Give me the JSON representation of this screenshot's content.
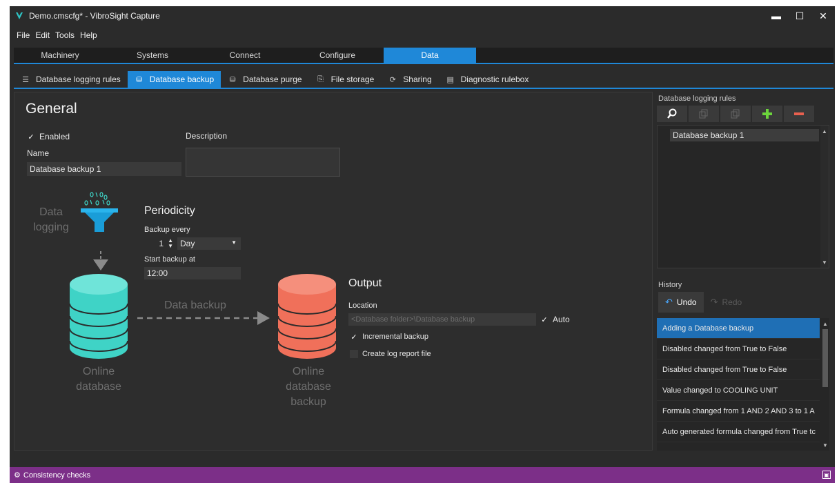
{
  "window": {
    "title": "Demo.cmscfg* - VibroSight Capture",
    "controls": {
      "minimize": "▬",
      "maximize": "☐",
      "close": "✕"
    }
  },
  "menu": [
    "File",
    "Edit",
    "Tools",
    "Help"
  ],
  "main_tabs": [
    {
      "label": "Machinery"
    },
    {
      "label": "Systems"
    },
    {
      "label": "Connect"
    },
    {
      "label": "Configure"
    },
    {
      "label": "Data"
    }
  ],
  "main_tab_active": "Data",
  "sub_tabs": [
    {
      "label": "Database logging rules",
      "icon": "list-rules-icon"
    },
    {
      "label": "Database backup",
      "icon": "database-backup-icon"
    },
    {
      "label": "Database purge",
      "icon": "database-purge-icon"
    },
    {
      "label": "File storage",
      "icon": "file-storage-icon"
    },
    {
      "label": "Sharing",
      "icon": "sharing-icon"
    },
    {
      "label": "Diagnostic rulebox",
      "icon": "rulebox-icon"
    }
  ],
  "sub_tab_active": "Database backup",
  "general": {
    "heading": "General",
    "enabled_label": "Enabled",
    "enabled": true,
    "name_label": "Name",
    "name_value": "Database backup 1",
    "description_label": "Description",
    "description_value": ""
  },
  "diagram": {
    "data_logging": "Data logging",
    "online_database": "Online database",
    "arrow_label": "Data backup",
    "online_backup": "Online database backup",
    "colors": {
      "online": "#3fd3c6",
      "backup": "#f0705a",
      "funnel": "#1a9dd8"
    }
  },
  "periodicity": {
    "heading": "Periodicity",
    "backup_every_label": "Backup every",
    "backup_every_value": "1",
    "unit_value": "Day",
    "start_label": "Start backup at",
    "start_value": "12:00"
  },
  "output": {
    "heading": "Output",
    "location_label": "Location",
    "location_value": "<Database folder>\\Database backup",
    "auto_label": "Auto",
    "auto": true,
    "incremental_label": "Incremental backup",
    "incremental": true,
    "log_report_label": "Create log report file",
    "log_report": false
  },
  "rules_panel": {
    "title": "Database logging rules",
    "items": [
      "Database backup 1"
    ]
  },
  "history": {
    "title": "History",
    "undo_label": "Undo",
    "redo_label": "Redo",
    "rows": [
      "Adding a Database backup",
      "Disabled changed from True to False",
      "Disabled changed from True to False",
      "Value changed to COOLING UNIT",
      "Formula changed from 1 AND 2 AND 3 to 1 A",
      "Auto generated formula changed from True tc"
    ]
  },
  "status": {
    "label": "Consistency checks"
  },
  "colors": {
    "accent": "#1f88d8",
    "status_bar": "#7c2f88",
    "background": "#2b2b2b"
  }
}
